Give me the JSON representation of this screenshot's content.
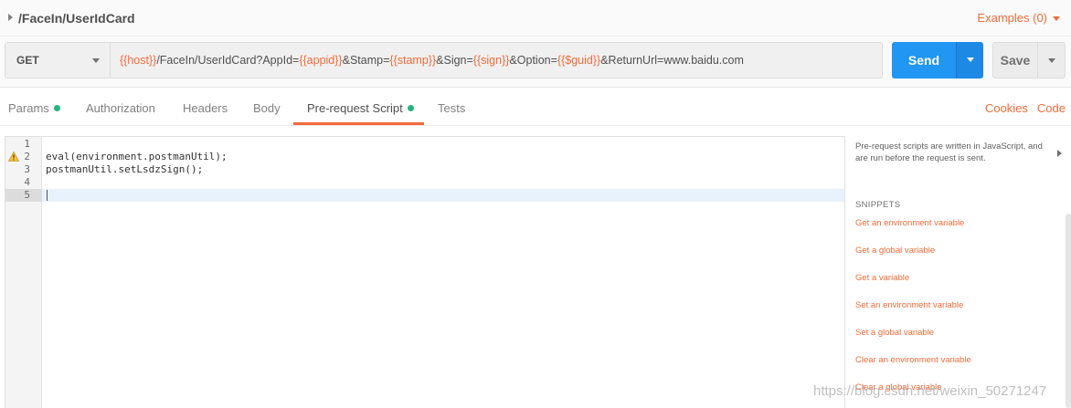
{
  "request": {
    "name": "/FaceIn/UserIdCard",
    "examples_label": "Examples (0)"
  },
  "url_bar": {
    "method": "GET",
    "url_segments": [
      {
        "text": "{{host}}",
        "var": true
      },
      {
        "text": "/FaceIn/UserIdCard?AppId=",
        "var": false
      },
      {
        "text": "{{appid}}",
        "var": true
      },
      {
        "text": "&Stamp=",
        "var": false
      },
      {
        "text": "{{stamp}}",
        "var": true
      },
      {
        "text": "&Sign=",
        "var": false
      },
      {
        "text": "{{sign}}",
        "var": true
      },
      {
        "text": "&Option=",
        "var": false
      },
      {
        "text": "{{$guid}}",
        "var": true
      },
      {
        "text": "&ReturnUrl=www.baidu.com",
        "var": false
      }
    ],
    "send_label": "Send",
    "save_label": "Save"
  },
  "tabs": [
    {
      "label": "Params",
      "dot": true
    },
    {
      "label": "Authorization",
      "dot": false
    },
    {
      "label": "Headers",
      "dot": false
    },
    {
      "label": "Body",
      "dot": false
    },
    {
      "label": "Pre-request Script",
      "dot": true,
      "active": true
    },
    {
      "label": "Tests",
      "dot": false
    }
  ],
  "right_links": {
    "cookies": "Cookies",
    "code": "Code"
  },
  "editor": {
    "lines": [
      {
        "num": "1",
        "code": ""
      },
      {
        "num": "2",
        "code": "eval(environment.postmanUtil);",
        "warning": true
      },
      {
        "num": "3",
        "code": "postmanUtil.setLsdzSign();"
      },
      {
        "num": "4",
        "code": ""
      },
      {
        "num": "5",
        "code": "",
        "active": true
      }
    ]
  },
  "side_panel": {
    "description": "Pre-request scripts are written in JavaScript, and are run before the request is sent.",
    "snippets_title": "SNIPPETS",
    "snippets": [
      "Get an environment variable",
      "Get a global variable",
      "Get a variable",
      "Set an environment variable",
      "Set a global variable",
      "Clear an environment variable",
      "Clear a global variable"
    ]
  },
  "watermark": "https://blog.csdn.net/weixin_50271247",
  "colors": {
    "accent": "#f26b3a",
    "send_blue": "#2196f3",
    "status_green": "#26b47f"
  }
}
